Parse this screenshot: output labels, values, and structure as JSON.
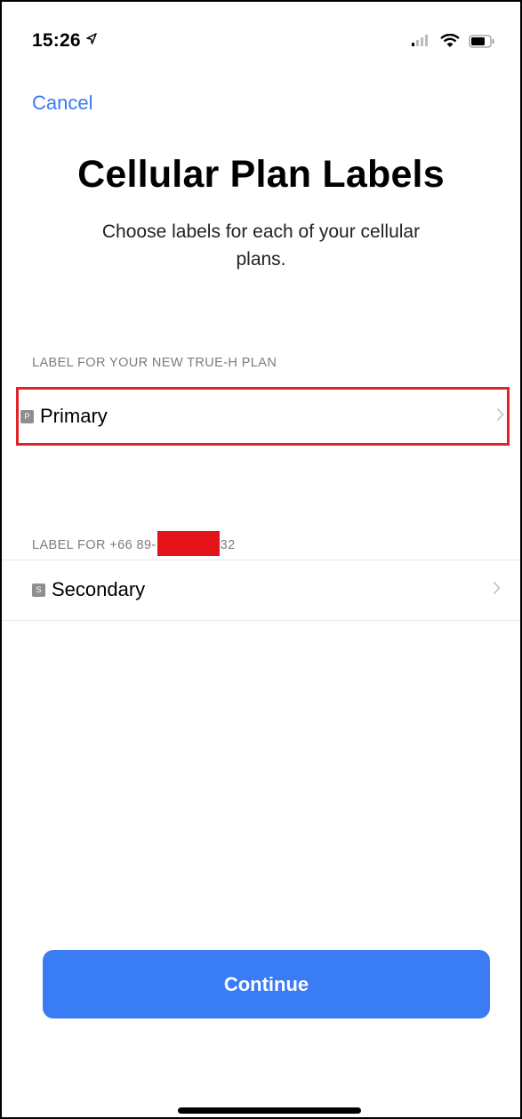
{
  "status_bar": {
    "time": "15:26",
    "location_icon": "location-arrow-icon",
    "signal_icon": "signal-bars-icon",
    "wifi_icon": "wifi-icon",
    "battery_icon": "battery-icon"
  },
  "nav": {
    "cancel_label": "Cancel"
  },
  "header": {
    "title": "Cellular Plan Labels",
    "subtitle": "Choose labels for each of your cellular plans."
  },
  "sections": [
    {
      "header": "LABEL FOR YOUR NEW TRUE-H PLAN",
      "row": {
        "icon_letter": "P",
        "label": "Primary",
        "highlighted": true
      }
    },
    {
      "header_prefix": "LABEL FOR +66 89-",
      "header_suffix": "32",
      "redacted": true,
      "row": {
        "icon_letter": "S",
        "label": "Secondary",
        "highlighted": false
      }
    }
  ],
  "footer": {
    "continue_label": "Continue"
  },
  "colors": {
    "accent": "#3a7cf3",
    "link": "#3a7af2",
    "highlight_border": "#e0242b",
    "redaction": "#e3141c",
    "section_header": "#7c7c80",
    "sim_icon": "#8e8e93"
  }
}
